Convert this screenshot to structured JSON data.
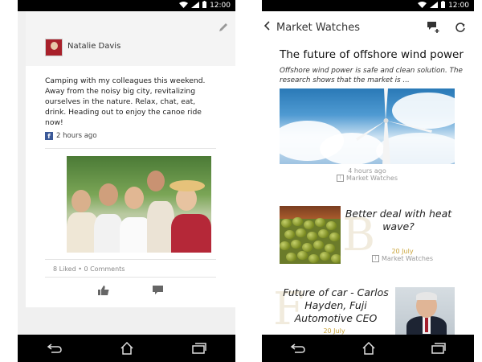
{
  "status_bar": {
    "time": "12:00"
  },
  "left_screen": {
    "post": {
      "author": "Natalie Davis",
      "text": "Camping with my colleagues this weekend. Away from the noisy big city, revitalizing ourselves in the nature. Relax, chat, eat, drink. Heading out to enjoy the canoe ride now!",
      "time_ago": "2 hours ago",
      "stats": "8 Liked • 0 Comments",
      "icons": [
        "pencil-icon",
        "facebook-icon",
        "thumbs-up-icon",
        "comment-icon"
      ]
    }
  },
  "right_screen": {
    "header": {
      "title": "Market Watches",
      "icons": [
        "back-chevron-icon",
        "add-comment-icon",
        "refresh-icon"
      ]
    },
    "articles": [
      {
        "title": "The future of offshore wind power",
        "summary": "Offshore wind power is safe and clean solution. The research shows that the market is ...",
        "time": "4 hours ago",
        "source": "Market Watches"
      },
      {
        "title": "Better deal with heat wave?",
        "date": "20 July",
        "source": "Market Watches",
        "watermark": "B"
      },
      {
        "title": "Future of car - Carlos Hayden, Fuji Automotive CEO",
        "date": "20 July",
        "watermark": "F"
      }
    ]
  },
  "nav_bar": {
    "icons": [
      "back-icon",
      "home-icon",
      "recents-icon"
    ]
  }
}
